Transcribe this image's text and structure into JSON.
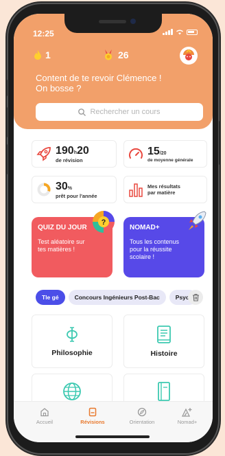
{
  "status": {
    "time": "12:25"
  },
  "header": {
    "streak": "1",
    "medals": "26",
    "welcome_line1": "Content de te revoir Clémence !",
    "welcome_line2": "On bosse ?"
  },
  "search": {
    "placeholder": "Rechercher un cours"
  },
  "stats": {
    "revision_hours": "190",
    "revision_h": "h",
    "revision_min": "20",
    "revision_label": "de révision",
    "average_value": "15",
    "average_denominator": "/20",
    "average_label": "de moyenne générale",
    "ready_value": "30",
    "ready_unit": "%",
    "ready_label": "prêt pour l'année",
    "ready_progress": 0.3,
    "results_label1": "Mes résultats",
    "results_label2": "par matière"
  },
  "cards": {
    "quiz_title": "QUIZ DU JOUR",
    "quiz_desc": "Test aléatoire sur tes matières !",
    "nomad_title": "NOMAD+",
    "nomad_desc": "Tous les contenus pour la réussite scolaire !"
  },
  "chips": [
    "Tle gé",
    "Concours Ingénieurs Post-Bac",
    "Psych"
  ],
  "subjects": [
    "Philosophie",
    "Histoire"
  ],
  "tabs": [
    "Accueil",
    "Révisions",
    "Orientation",
    "Nomad+"
  ],
  "colors": {
    "header": "#f2a06a",
    "accent": "#e8782c",
    "quiz": "#f15b5f",
    "nomad": "#5749e8",
    "chip_active": "#4b4ee8"
  }
}
